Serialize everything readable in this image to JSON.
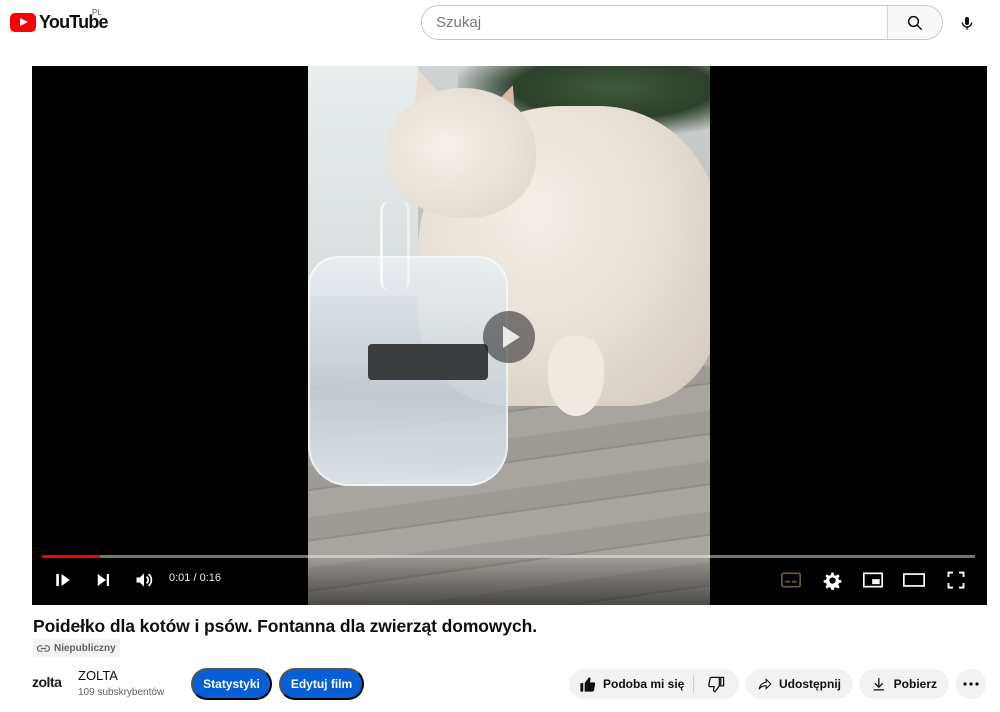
{
  "header": {
    "logo_text": "YouTube",
    "country_code": "PL",
    "search_placeholder": "Szukaj"
  },
  "player": {
    "time_current": "0:01",
    "time_separator": " / ",
    "time_total": "0:16",
    "progress_fraction": 0.0625
  },
  "video": {
    "title": "Poidełko dla kotów i psów. Fontanna dla zwierząt domowych.",
    "visibility": "Niepubliczny"
  },
  "channel": {
    "logo_text": "zolta",
    "name": "ZOLTA",
    "subscribers": "109 subskrybentów"
  },
  "actions": {
    "stats_label": "Statystyki",
    "edit_label": "Edytuj film",
    "like_label": "Podoba mi się",
    "share_label": "Udostępnij",
    "download_label": "Pobierz"
  },
  "colors": {
    "brand_red": "#ff0000",
    "action_blue": "#065fd4",
    "pill_bg": "#f2f2f2"
  }
}
